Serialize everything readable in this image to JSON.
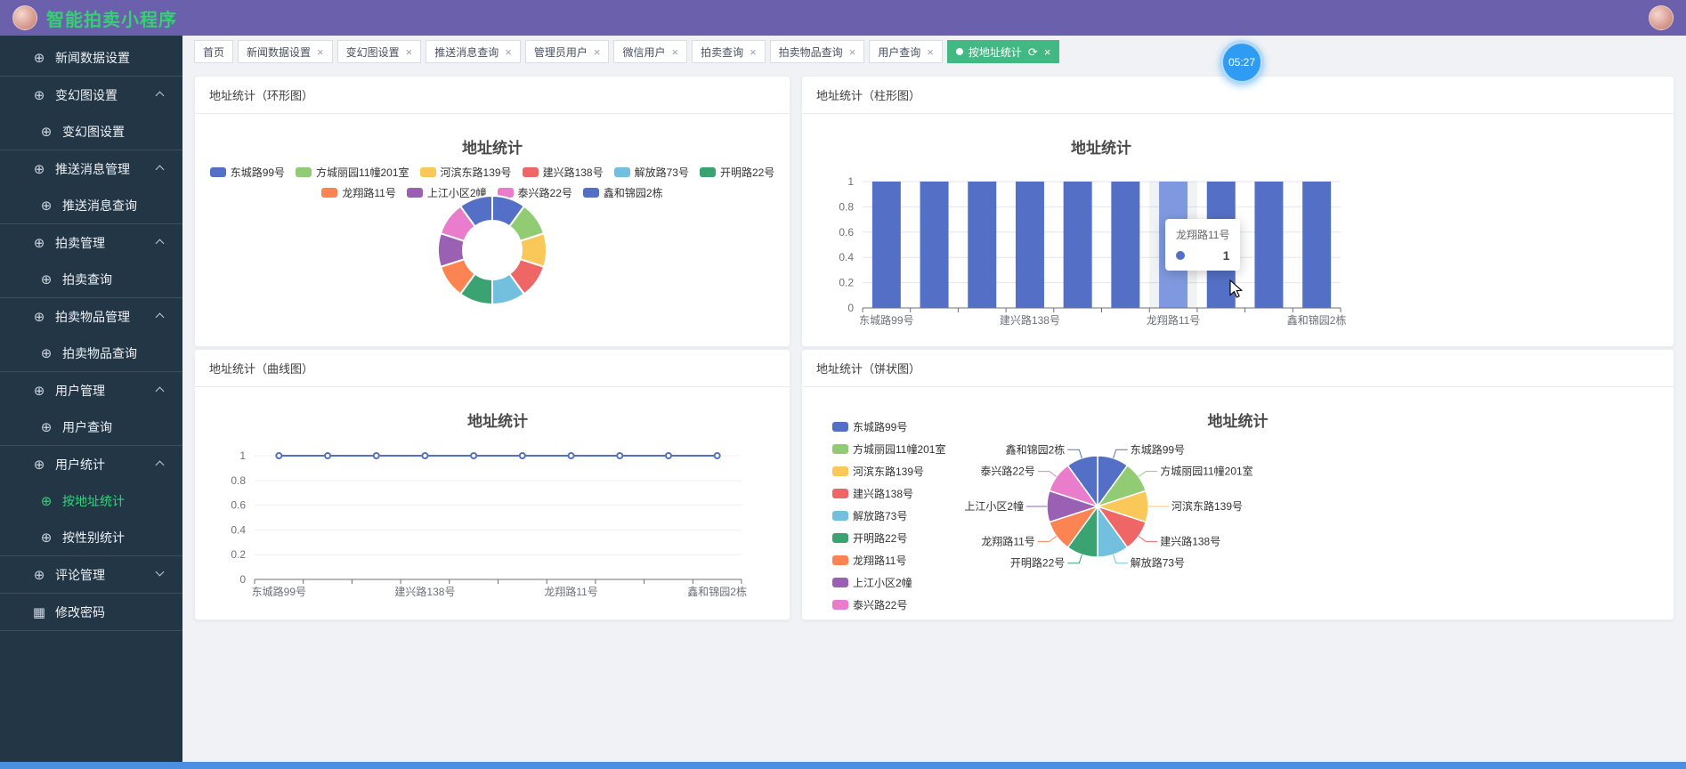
{
  "header": {
    "title": "智能拍卖小程序"
  },
  "timer": {
    "value": "05:27"
  },
  "sidebar": {
    "sections": [
      {
        "label": "新闻数据设置",
        "type": "item",
        "icon": "globe"
      },
      {
        "label": "变幻图设置",
        "type": "group",
        "expanded": true,
        "subs": [
          {
            "label": "变幻图设置"
          }
        ]
      },
      {
        "label": "推送消息管理",
        "type": "group",
        "expanded": true,
        "subs": [
          {
            "label": "推送消息查询"
          }
        ]
      },
      {
        "label": "拍卖管理",
        "type": "group",
        "expanded": true,
        "subs": [
          {
            "label": "拍卖查询"
          }
        ]
      },
      {
        "label": "拍卖物品管理",
        "type": "group",
        "expanded": true,
        "subs": [
          {
            "label": "拍卖物品查询"
          }
        ]
      },
      {
        "label": "用户管理",
        "type": "group",
        "expanded": true,
        "subs": [
          {
            "label": "用户查询"
          }
        ]
      },
      {
        "label": "用户统计",
        "type": "group",
        "expanded": true,
        "subs": [
          {
            "label": "按地址统计",
            "active": true
          },
          {
            "label": "按性别统计"
          }
        ]
      },
      {
        "label": "评论管理",
        "type": "group",
        "expanded": false,
        "subs": []
      },
      {
        "label": "修改密码",
        "type": "item",
        "icon": "grid"
      }
    ]
  },
  "tabs": [
    {
      "label": "首页",
      "closable": false
    },
    {
      "label": "新闻数据设置",
      "closable": true
    },
    {
      "label": "变幻图设置",
      "closable": true
    },
    {
      "label": "推送消息查询",
      "closable": true
    },
    {
      "label": "管理员用户",
      "closable": true
    },
    {
      "label": "微信用户",
      "closable": true
    },
    {
      "label": "拍卖查询",
      "closable": true
    },
    {
      "label": "拍卖物品查询",
      "closable": true
    },
    {
      "label": "用户查询",
      "closable": true
    },
    {
      "label": "按地址统计",
      "closable": true,
      "active": true,
      "refresh": true
    }
  ],
  "panels": {
    "donut": {
      "title": "地址统计（环形图）"
    },
    "bar": {
      "title": "地址统计（柱形图）"
    },
    "line": {
      "title": "地址统计（曲线图）"
    },
    "pie": {
      "title": "地址统计（饼状图）"
    }
  },
  "colors": {
    "header_bg": "#6b60ab",
    "sidebar_bg": "#233646",
    "accent_green": "#42b983",
    "active_menu_green": "#2fd57c",
    "timer_blue": "#2f9cf4",
    "background": "#f0f2f5"
  },
  "chart_data": [
    {
      "id": "donut",
      "type": "pie",
      "subtype": "donut",
      "title": "地址统计",
      "legend_position": "top",
      "legend_rows": [
        6,
        4
      ],
      "categories": [
        "东城路99号",
        "方城丽园11幢201室",
        "河滨东路139号",
        "建兴路138号",
        "解放路73号",
        "开明路22号",
        "龙翔路11号",
        "上江小区2幢",
        "泰兴路22号",
        "鑫和锦园2栋"
      ],
      "values": [
        1,
        1,
        1,
        1,
        1,
        1,
        1,
        1,
        1,
        1
      ],
      "colors": [
        "#5470c6",
        "#91cc75",
        "#fac858",
        "#ee6666",
        "#73c0de",
        "#3ba272",
        "#fc8452",
        "#9a60b4",
        "#ea7ccc",
        "#5470c6"
      ]
    },
    {
      "id": "bar",
      "type": "bar",
      "title": "地址统计",
      "categories": [
        "东城路99号",
        "方城丽园11幢201室",
        "河滨东路139号",
        "建兴路138号",
        "解放路73号",
        "开明路22号",
        "龙翔路11号",
        "上江小区2幢",
        "泰兴路22号",
        "鑫和锦园2栋"
      ],
      "values": [
        1,
        1,
        1,
        1,
        1,
        1,
        1,
        1,
        1,
        1
      ],
      "ylim": [
        0,
        1
      ],
      "yticks": [
        0,
        0.2,
        0.4,
        0.6,
        0.8,
        1
      ],
      "xtick_shown_indices": [
        0,
        3,
        6,
        9
      ],
      "xtick_shown_labels": [
        "东城路99号",
        "建兴路138号",
        "龙翔路11号",
        "鑫和锦园2栋"
      ],
      "bar_color": "#5470c6",
      "highlight_index": 6,
      "highlight_color": "#7f99e0",
      "grid": true,
      "tooltip": {
        "label": "龙翔路11号",
        "value": "1"
      }
    },
    {
      "id": "line",
      "type": "line",
      "title": "地址统计",
      "categories": [
        "东城路99号",
        "方城丽园11幢201室",
        "河滨东路139号",
        "建兴路138号",
        "解放路73号",
        "开明路22号",
        "龙翔路11号",
        "上江小区2幢",
        "泰兴路22号",
        "鑫和锦园2栋"
      ],
      "values": [
        1,
        1,
        1,
        1,
        1,
        1,
        1,
        1,
        1,
        1
      ],
      "ylim": [
        0,
        1
      ],
      "yticks": [
        0,
        0.2,
        0.4,
        0.6,
        0.8,
        1
      ],
      "xtick_shown_indices": [
        0,
        3,
        6,
        9
      ],
      "xtick_shown_labels": [
        "东城路99号",
        "建兴路138号",
        "龙翔路11号",
        "鑫和锦园2栋"
      ],
      "line_color": "#5470c6",
      "marker": "emptyCircle",
      "grid": true
    },
    {
      "id": "pie",
      "type": "pie",
      "subtype": "pie",
      "title": "地址统计",
      "legend_position": "left",
      "labels_shown": true,
      "categories": [
        "东城路99号",
        "方城丽园11幢201室",
        "河滨东路139号",
        "建兴路138号",
        "解放路73号",
        "开明路22号",
        "龙翔路11号",
        "上江小区2幢",
        "泰兴路22号",
        "鑫和锦园2栋"
      ],
      "values": [
        1,
        1,
        1,
        1,
        1,
        1,
        1,
        1,
        1,
        1
      ],
      "colors": [
        "#5470c6",
        "#91cc75",
        "#fac858",
        "#ee6666",
        "#73c0de",
        "#3ba272",
        "#fc8452",
        "#9a60b4",
        "#ea7ccc",
        "#5470c6"
      ]
    }
  ]
}
